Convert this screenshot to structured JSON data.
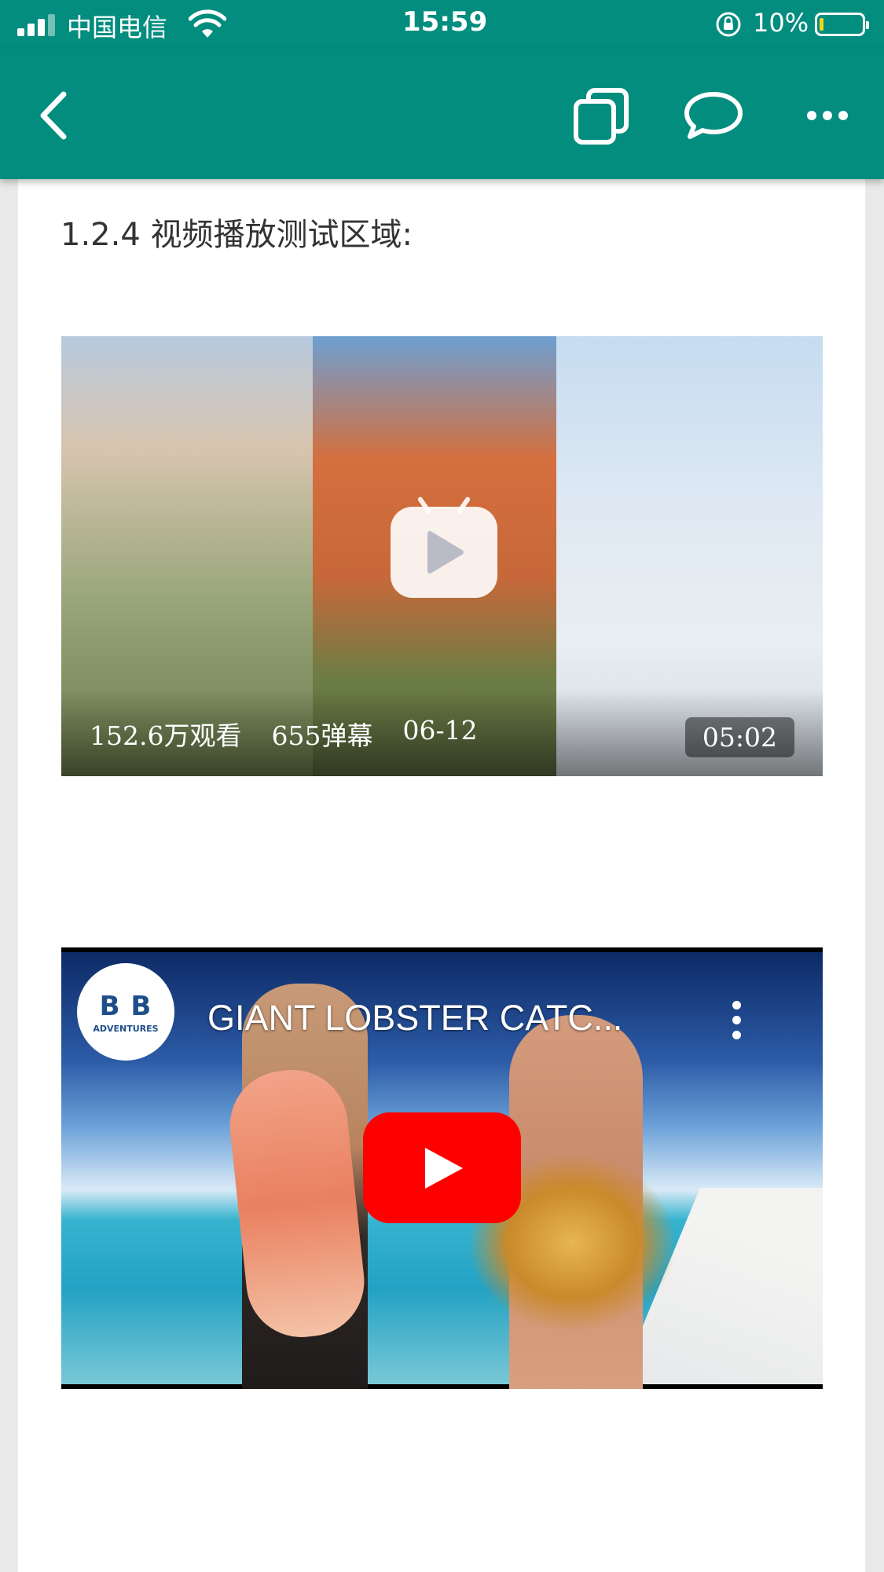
{
  "status_bar": {
    "carrier": "中国电信",
    "time": "15:59",
    "battery_percent": "10%",
    "battery_level": 0.1,
    "battery_color": "#f5d418"
  },
  "toolbar": {
    "background": "#038d7e",
    "icons": [
      "back-arrow-icon",
      "copy-icon",
      "comment-icon",
      "more-icon"
    ]
  },
  "content": {
    "section_heading": "1.2.4 视频播放测试区域:",
    "bilibili_video": {
      "views": "152.6万观看",
      "danmaku": "655弹幕",
      "date": "06-12",
      "duration": "05:02"
    },
    "youtube_video": {
      "channel_logo_text": "B B",
      "channel_logo_sub": "ADVENTURES",
      "title": "GIANT LOBSTER CATC...",
      "play_button_color": "#ff0000"
    }
  }
}
